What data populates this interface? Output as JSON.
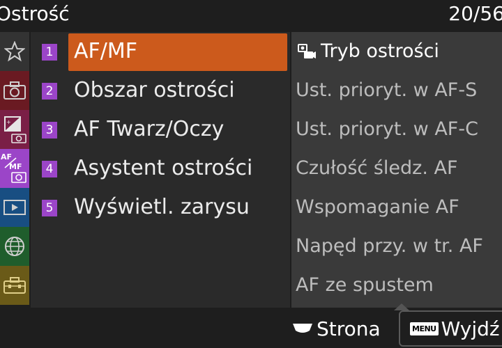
{
  "header": {
    "title": "Ostrość",
    "page": "20/56"
  },
  "sidebar": {
    "icons": [
      {
        "name": "star-icon",
        "color": "#333333"
      },
      {
        "name": "camera-icon",
        "color": "#6a1a22"
      },
      {
        "name": "exposure-camera-icon",
        "color": "#7a1f46"
      },
      {
        "name": "af-mf-camera-icon",
        "color": "#9b45c8"
      },
      {
        "name": "playback-icon",
        "color": "#184e82"
      },
      {
        "name": "globe-icon",
        "color": "#1f5d2c"
      },
      {
        "name": "toolbox-icon",
        "color": "#6a5a18"
      }
    ]
  },
  "menu": {
    "items": [
      {
        "num": "1",
        "label": "AF/MF",
        "selected": true
      },
      {
        "num": "2",
        "label": "Obszar ostrości"
      },
      {
        "num": "3",
        "label": "AF Twarz/Oczy"
      },
      {
        "num": "4",
        "label": "Asystent ostrości"
      },
      {
        "num": "5",
        "label": "Wyświetl. zarysu"
      }
    ],
    "accent": "#cc5a1c",
    "badge_color": "#9b45c8"
  },
  "submenu": {
    "items": [
      {
        "label": "Tryb ostrości"
      },
      {
        "label": "Ust. prioryt. w AF-S"
      },
      {
        "label": "Ust. prioryt. w AF-C"
      },
      {
        "label": "Czułość śledz. AF"
      },
      {
        "label": "Wspomaganie AF"
      },
      {
        "label": "Napęd przy. w tr. AF"
      },
      {
        "label": "AF ze spustem"
      }
    ]
  },
  "footer": {
    "page_label": "Strona",
    "menu_key": "MENU",
    "exit_label": "Wyjdź"
  }
}
